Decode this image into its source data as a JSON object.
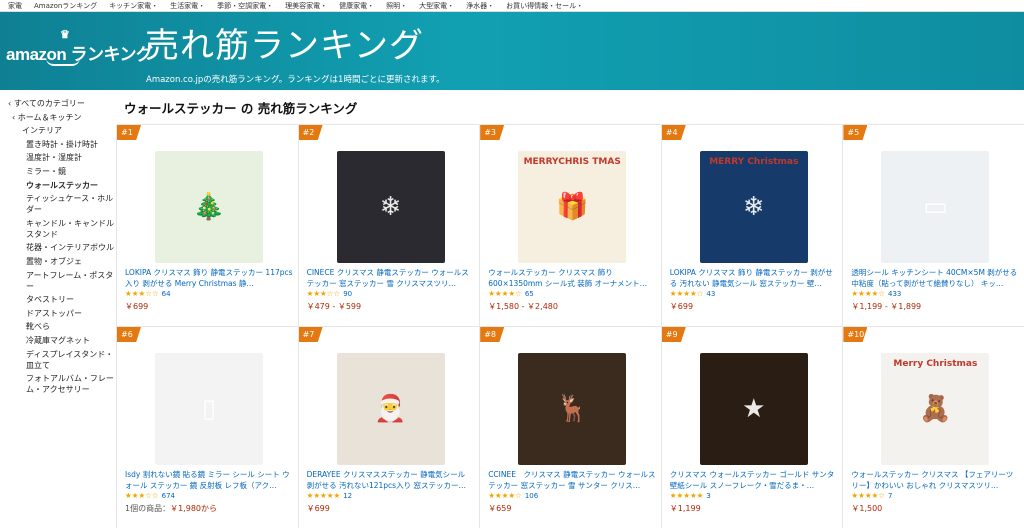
{
  "topnav": [
    "家電",
    "Amazonランキング",
    "キッチン家電・",
    "生活家電・",
    "季節・空調家電・",
    "理美容家電・",
    "健康家電・",
    "照明・",
    "大型家電・",
    "浄水器・",
    "お買い得情報・セール・"
  ],
  "banner": {
    "logo": "amazon ランキング",
    "title": "売れ筋ランキング",
    "subtitle": "Amazon.co.jpの売れ筋ランキング。ランキングは1時間ごとに更新されます。"
  },
  "sidebar": [
    {
      "label": "‹ すべてのカテゴリー",
      "level": 0
    },
    {
      "label": "‹ ホーム＆キッチン",
      "level": 1
    },
    {
      "label": "インテリア",
      "level": 2
    },
    {
      "label": "置き時計・掛け時計",
      "level": 3
    },
    {
      "label": "温度計・湿度計",
      "level": 3
    },
    {
      "label": "ミラー・鏡",
      "level": 3
    },
    {
      "label": "ウォールステッカー",
      "level": 3,
      "bold": true
    },
    {
      "label": "ティッシュケース・ホルダー",
      "level": 3
    },
    {
      "label": "キャンドル・キャンドルスタンド",
      "level": 3
    },
    {
      "label": "花器・インテリアボウル",
      "level": 3
    },
    {
      "label": "置物・オブジェ",
      "level": 3
    },
    {
      "label": "アートフレーム・ポスター",
      "level": 3
    },
    {
      "label": "タペストリー",
      "level": 3
    },
    {
      "label": "ドアストッパー",
      "level": 3
    },
    {
      "label": "靴べら",
      "level": 3
    },
    {
      "label": "冷蔵庫マグネット",
      "level": 3
    },
    {
      "label": "ディスプレイスタンド・皿立て",
      "level": 3
    },
    {
      "label": "フォトアルバム・フレーム・アクセサリー",
      "level": 3
    }
  ],
  "page_title": "ウォールステッカー の 売れ筋ランキング",
  "products": [
    {
      "rank": "#1",
      "title": "LOKIPA クリスマス 飾り 静電ステッカー 117pcs入り 剥がせる Merry Christmas 静…",
      "stars": "★★★☆☆",
      "count": "64",
      "price": "￥699",
      "img_color": "#e8f0e0",
      "glyph": "🎄"
    },
    {
      "rank": "#2",
      "title": "CINECE クリスマス 静電ステッカー ウォールステッカー 窓ステッカー 雪 クリスマスツリ…",
      "stars": "★★★☆☆",
      "count": "90",
      "price": "￥479 - ￥599",
      "img_color": "#2a2a30",
      "glyph": "❄"
    },
    {
      "rank": "#3",
      "title": "ウォールステッカー クリスマス 飾り 600×1350mm シール式 装飾 オーナメント…",
      "stars": "★★★★☆",
      "count": "65",
      "price": "￥1,580 - ￥2,480",
      "img_color": "#f6efe0",
      "glyph": "🎁",
      "img_text": "MERRYCHRIS TMAS"
    },
    {
      "rank": "#4",
      "title": "LOKIPA クリスマス 飾り 静電ステッカー 剥がせる 汚れない 静電気シール 窓ステッカー 壁…",
      "stars": "★★★★☆",
      "count": "43",
      "price": "￥699",
      "img_color": "#163a6a",
      "glyph": "❄",
      "img_text": "MERRY Christmas"
    },
    {
      "rank": "#5",
      "title": "透明シール キッチンシート 40CM×5M 剥がせる中粘度（貼って剥がせて絶賛りなし） キッ…",
      "stars": "★★★★☆",
      "count": "433",
      "price": "￥1,199 - ￥1,899",
      "img_color": "#eef1f3",
      "glyph": "▭"
    },
    {
      "rank": "#6",
      "title": "Isdy 割れない鏡 貼る鏡 ミラー シール シート ウォール ステッカー 鏡 反射板 レフ板（アク…",
      "stars": "★★★☆☆",
      "count": "674",
      "price_prefix": "1個の商品：",
      "price": "￥1,980から",
      "img_color": "#f3f3f3",
      "glyph": "▯"
    },
    {
      "rank": "#7",
      "title": "DERAYEE クリスマスステッカー 静電気シール 剥がせる 汚れない121pcs入り 窓ステッカー…",
      "stars": "★★★★★",
      "count": "12",
      "price": "￥699",
      "img_color": "#e9e2d8",
      "glyph": "🎅"
    },
    {
      "rank": "#8",
      "title": "CCINEE　クリスマス 静電ステッカー ウォールステッカー 窓ステッカー 雪 サンター クリス…",
      "stars": "★★★★☆",
      "count": "106",
      "price": "￥659",
      "img_color": "#3b2a1e",
      "glyph": "🦌"
    },
    {
      "rank": "#9",
      "title": "クリスマス ウォールステッカー ゴールド サンタ 壁紙シール スノーフレーク・雪だるま・…",
      "stars": "★★★★★",
      "count": "3",
      "price": "￥1,199",
      "img_color": "#2a1e14",
      "glyph": "★"
    },
    {
      "rank": "#10",
      "title": "ウォールステッカー クリスマス 【フェアリーツリー】かわいい おしゃれ クリスマスツリ…",
      "stars": "★★★★☆",
      "count": "7",
      "price": "￥1,500",
      "img_color": "#f4f2ee",
      "glyph": "🧸",
      "img_text": "Merry Christmas"
    }
  ]
}
